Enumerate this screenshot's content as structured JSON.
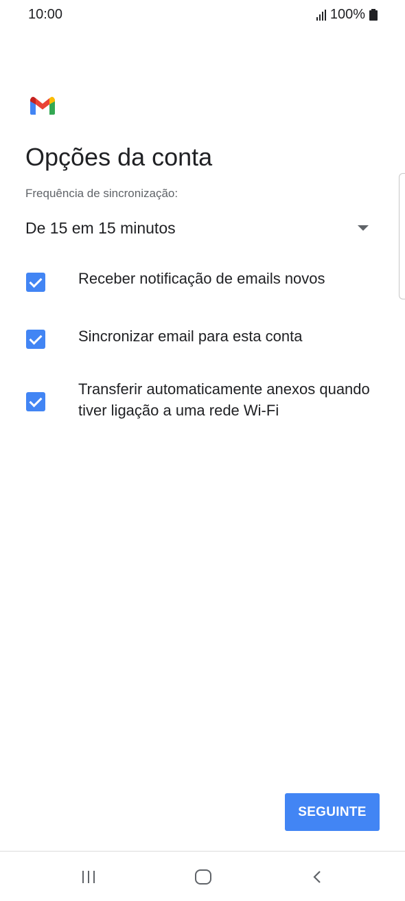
{
  "status_bar": {
    "time": "10:00",
    "battery": "100%",
    "icons": [
      "signal-icon",
      "battery-icon"
    ]
  },
  "header": {
    "logo": "gmail-logo",
    "title": "Opções da conta"
  },
  "sync": {
    "label": "Frequência de sincronização:",
    "selected": "De 15 em 15 minutos"
  },
  "options": [
    {
      "label": "Receber notificação de emails novos",
      "checked": true
    },
    {
      "label": "Sincronizar email para esta conta",
      "checked": true
    },
    {
      "label": "Transferir automaticamente anexos quando tiver ligação a uma rede Wi-Fi",
      "checked": true
    }
  ],
  "actions": {
    "next_label": "SEGUINTE"
  },
  "colors": {
    "accent": "#4285f4",
    "text": "#202124",
    "secondary_text": "#5f6368"
  },
  "nav_bar": {
    "icons": [
      "recent-apps-icon",
      "home-icon",
      "back-icon"
    ]
  }
}
